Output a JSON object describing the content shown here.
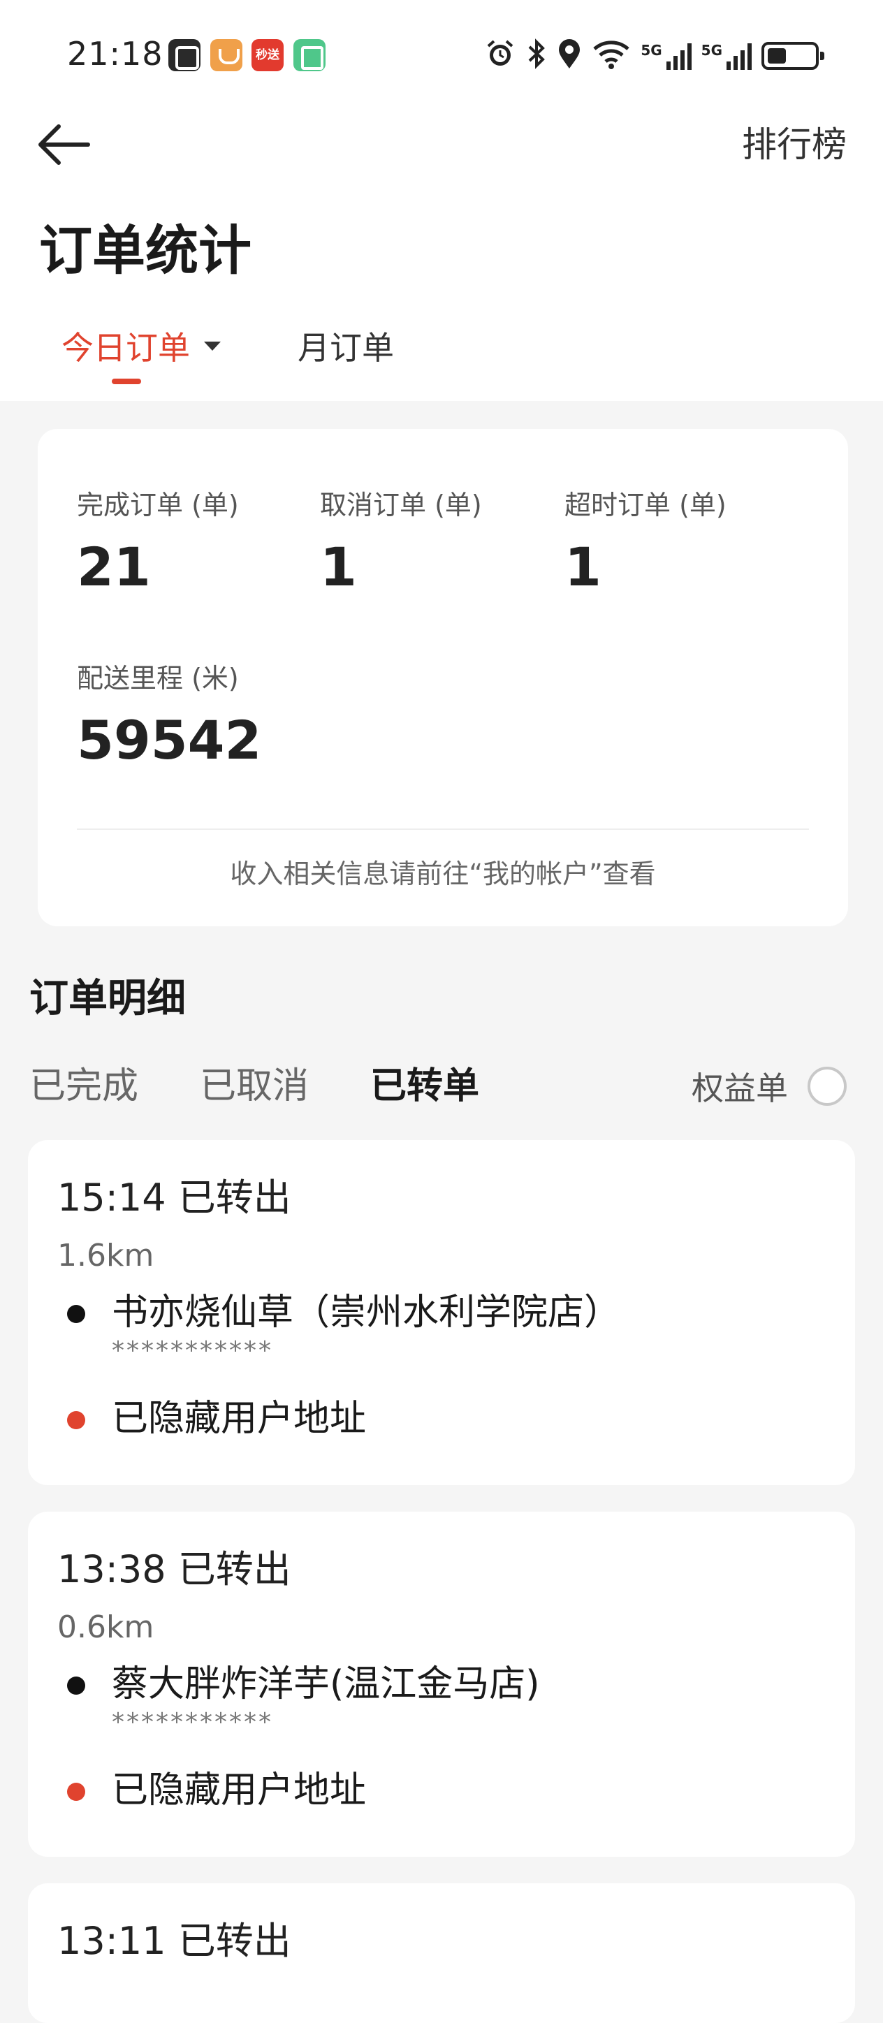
{
  "status_bar": {
    "time": "21:18",
    "app_icons": [
      "nfc-icon",
      "orange-app-icon",
      "miaosong-app-icon",
      "green-app-icon"
    ],
    "miaosong_label": "秒送",
    "indicator_icons": [
      "alarm-icon",
      "bluetooth-icon",
      "location-icon",
      "wifi-icon",
      "signal-5g-icon",
      "signal-5g-icon",
      "battery-icon"
    ],
    "network_tag": "5G"
  },
  "header": {
    "back_icon": "arrow-left-icon",
    "ranking_label": "排行榜",
    "title": "订单统计"
  },
  "tabs": {
    "today_label": "今日订单",
    "month_label": "月订单",
    "active": "today",
    "accent_color": "#e0432e"
  },
  "stats": {
    "completed": {
      "label": "完成订单 (单)",
      "value": "21"
    },
    "cancelled": {
      "label": "取消订单 (单)",
      "value": "1"
    },
    "overtime": {
      "label": "超时订单 (单)",
      "value": "1"
    },
    "distance": {
      "label": "配送里程 (米)",
      "value": "59542"
    },
    "note": "收入相关信息请前往“我的帐户”查看"
  },
  "details": {
    "title": "订单明细",
    "tabs": {
      "done": "已完成",
      "cancelled": "已取消",
      "transferred": "已转单"
    },
    "active_tab": "transferred",
    "benefit_label": "权益单",
    "benefit_checked": false
  },
  "orders": [
    {
      "head": "15:14 已转出",
      "distance": "1.6km",
      "shop": "书亦烧仙草（崇州水利学院店）",
      "mask": "***********",
      "address": "已隐藏用户地址"
    },
    {
      "head": "13:38 已转出",
      "distance": "0.6km",
      "shop": "蔡大胖炸洋芋(温江金马店)",
      "mask": "***********",
      "address": "已隐藏用户地址"
    },
    {
      "head": "13:11 已转出"
    }
  ]
}
